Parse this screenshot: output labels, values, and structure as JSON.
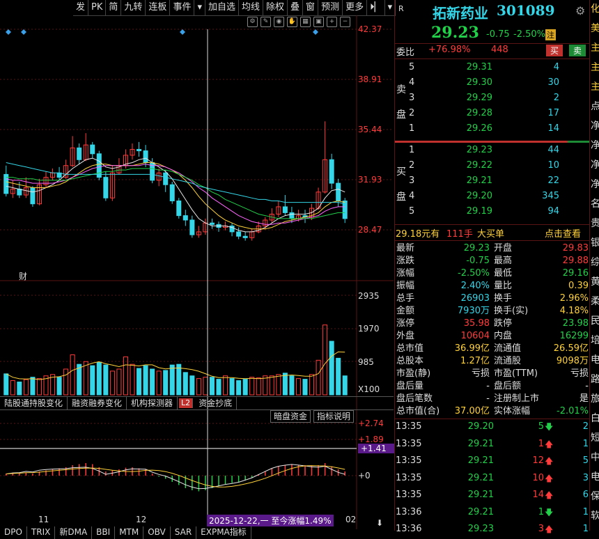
{
  "toolbar": {
    "items": [
      "发",
      "PK",
      "简",
      "九转",
      "连板",
      "事件",
      "加自选",
      "均线",
      "除权",
      "叠",
      "窗",
      "预测",
      "更多"
    ]
  },
  "stock": {
    "name": "拓新药业",
    "code": "301089",
    "price": "29.23",
    "change": "-0.75",
    "change_pct": "-2.50%",
    "badge": "注",
    "r_label": "R"
  },
  "weibi": {
    "label": "委比",
    "pct": "+76.98%",
    "vol": "448",
    "buy": "买",
    "sell": "卖"
  },
  "sell_label": [
    "卖",
    "盘"
  ],
  "buy_label": [
    "买",
    "盘"
  ],
  "asks": [
    {
      "n": "5",
      "p": "29.31",
      "v": "4"
    },
    {
      "n": "4",
      "p": "29.30",
      "v": "30"
    },
    {
      "n": "3",
      "p": "29.29",
      "v": "2"
    },
    {
      "n": "2",
      "p": "29.28",
      "v": "17"
    },
    {
      "n": "1",
      "p": "29.26",
      "v": "14"
    }
  ],
  "bids": [
    {
      "n": "1",
      "p": "29.23",
      "v": "44"
    },
    {
      "n": "2",
      "p": "29.22",
      "v": "10"
    },
    {
      "n": "3",
      "p": "29.21",
      "v": "22"
    },
    {
      "n": "4",
      "p": "29.20",
      "v": "345"
    },
    {
      "n": "5",
      "p": "29.19",
      "v": "94"
    }
  ],
  "big_order": {
    "price": "29.18元有",
    "hands": "111手",
    "label": "大买单",
    "link": "点击查看"
  },
  "stats": [
    [
      "最新",
      "29.23",
      "开盘",
      "29.83"
    ],
    [
      "涨跌",
      "-0.75",
      "最高",
      "29.88"
    ],
    [
      "涨幅",
      "-2.50%",
      "最低",
      "29.16"
    ],
    [
      "振幅",
      "2.40%",
      "量比",
      "0.39"
    ],
    [
      "总手",
      "26903",
      "换手",
      "2.96%"
    ],
    [
      "金额",
      "7930万",
      "换手(实)",
      "4.18%"
    ],
    [
      "涨停",
      "35.98",
      "跌停",
      "23.98"
    ],
    [
      "外盘",
      "10604",
      "内盘",
      "16299"
    ],
    [
      "总市值",
      "36.99亿",
      "流通值",
      "26.59亿"
    ],
    [
      "总股本",
      "1.27亿",
      "流通股",
      "9098万"
    ],
    [
      "市盈(静)",
      "亏损",
      "市盈(TTM)",
      "亏损"
    ],
    [
      "盘后量",
      "-",
      "盘后额",
      "-"
    ],
    [
      "盘后笔数",
      "-",
      "注册制上市",
      "是"
    ],
    [
      "总市值(合)",
      "37.00亿",
      "实体涨幅",
      "-2.01%"
    ]
  ],
  "ticks": [
    {
      "t": "13:35",
      "p": "29.20",
      "v": "5",
      "d": "down",
      "n": "2"
    },
    {
      "t": "13:35",
      "p": "29.21",
      "v": "1",
      "d": "up",
      "n": "1"
    },
    {
      "t": "13:35",
      "p": "29.21",
      "v": "12",
      "d": "up",
      "n": "5"
    },
    {
      "t": "13:35",
      "p": "29.21",
      "v": "10",
      "d": "up",
      "n": "3"
    },
    {
      "t": "13:35",
      "p": "29.21",
      "v": "14",
      "d": "up",
      "n": "6"
    },
    {
      "t": "13:36",
      "p": "29.21",
      "v": "1",
      "d": "down",
      "n": "1"
    },
    {
      "t": "13:36",
      "p": "29.23",
      "v": "3",
      "d": "up",
      "n": "1"
    }
  ],
  "price_axis": [
    "42.37",
    "38.91",
    "35.44",
    "31.93",
    "28.47"
  ],
  "vol_axis": [
    "2935",
    "1970",
    "985",
    "X100"
  ],
  "macd_axis": [
    {
      "v": "+2.74",
      "c": "#ff3b3b"
    },
    {
      "v": "+1.89",
      "c": "#ff3b3b"
    },
    {
      "v": "+1.41",
      "c": "#ffffff"
    },
    {
      "v": "+0",
      "c": "#dddddd"
    }
  ],
  "cai_label": "财",
  "tabs": [
    "陆股通持股变化",
    "融资融券变化",
    "机构探测器",
    "L2",
    "资金抄底"
  ],
  "sub_buttons": [
    "暗盘资金",
    "指标说明"
  ],
  "date_labels": [
    "11",
    "12",
    "02"
  ],
  "crosshair_note": "2025-12-22,一 至今涨幅1.49%",
  "bottom_tabs": [
    "DPO",
    "TRIX",
    "新DMA",
    "BBI",
    "MTM",
    "OBV",
    "SAR",
    "EXPMA指标"
  ],
  "far_right": [
    "化",
    "美",
    "主",
    "主",
    "主",
    "点",
    "净",
    "净",
    "净",
    "净",
    "名",
    "贵",
    "银",
    "综",
    "黄",
    "柔",
    "民",
    "培",
    "电",
    "路",
    "旅",
    "白",
    "短",
    "中",
    "电",
    "保",
    "软"
  ],
  "chart_data": {
    "type": "candlestick",
    "ylim": [
      27.5,
      43.0
    ],
    "candles": [
      [
        32.8,
        31.5,
        33.4,
        31.3
      ],
      [
        31.5,
        31.8,
        32.4,
        31.2
      ],
      [
        31.8,
        31.4,
        32.3,
        31.2
      ],
      [
        31.4,
        31.9,
        32.6,
        31.2
      ],
      [
        31.9,
        30.8,
        32.0,
        30.6
      ],
      [
        30.8,
        32.1,
        32.5,
        30.7
      ],
      [
        32.1,
        32.6,
        33.0,
        31.9
      ],
      [
        32.6,
        32.9,
        33.2,
        32.4
      ],
      [
        32.9,
        32.6,
        33.3,
        32.4
      ],
      [
        32.6,
        33.4,
        33.8,
        32.5
      ],
      [
        33.4,
        34.6,
        35.4,
        33.3
      ],
      [
        34.6,
        33.8,
        34.9,
        33.5
      ],
      [
        33.8,
        34.8,
        35.6,
        33.7
      ],
      [
        34.8,
        34.2,
        35.0,
        33.9
      ],
      [
        34.2,
        32.6,
        34.4,
        32.4
      ],
      [
        32.6,
        31.2,
        33.0,
        31.0
      ],
      [
        31.2,
        32.9,
        33.4,
        31.0
      ],
      [
        32.9,
        33.4,
        33.9,
        32.8
      ],
      [
        33.4,
        34.1,
        34.5,
        33.2
      ],
      [
        34.1,
        34.5,
        34.9,
        33.8
      ],
      [
        34.5,
        34.4,
        35.0,
        34.0
      ],
      [
        34.4,
        33.6,
        34.8,
        33.3
      ],
      [
        33.6,
        32.4,
        33.9,
        32.2
      ],
      [
        32.4,
        32.9,
        33.2,
        32.0
      ],
      [
        32.9,
        32.1,
        33.1,
        31.6
      ],
      [
        32.1,
        31.0,
        32.3,
        30.8
      ],
      [
        31.0,
        30.0,
        31.2,
        29.8
      ],
      [
        30.0,
        29.7,
        30.4,
        29.3
      ],
      [
        29.7,
        28.7,
        30.0,
        28.5
      ],
      [
        28.7,
        28.9,
        29.3,
        28.5
      ],
      [
        28.9,
        29.5,
        29.8,
        28.7
      ],
      [
        29.5,
        29.4,
        29.8,
        29.1
      ],
      [
        29.4,
        29.2,
        29.6,
        28.9
      ],
      [
        29.2,
        29.3,
        29.6,
        29.0
      ],
      [
        29.3,
        28.9,
        29.5,
        28.6
      ],
      [
        28.9,
        28.6,
        29.2,
        28.4
      ],
      [
        28.6,
        28.5,
        28.9,
        28.3
      ],
      [
        28.5,
        28.9,
        29.1,
        28.3
      ],
      [
        28.9,
        29.3,
        29.6,
        28.8
      ],
      [
        29.3,
        29.7,
        29.9,
        29.1
      ],
      [
        29.7,
        30.1,
        30.5,
        29.5
      ],
      [
        30.1,
        30.6,
        31.0,
        29.9
      ],
      [
        30.6,
        30.2,
        31.4,
        30.0
      ],
      [
        30.2,
        29.8,
        30.6,
        29.5
      ],
      [
        29.8,
        30.0,
        30.4,
        29.6
      ],
      [
        30.0,
        29.9,
        30.4,
        29.5
      ],
      [
        29.9,
        30.5,
        30.8,
        29.7
      ],
      [
        30.5,
        31.6,
        31.9,
        30.4
      ],
      [
        31.6,
        33.8,
        36.4,
        31.5
      ],
      [
        33.8,
        32.2,
        34.2,
        31.8
      ],
      [
        32.2,
        31.0,
        32.5,
        30.6
      ],
      [
        31.0,
        29.8,
        31.2,
        29.5
      ]
    ],
    "ma_lines": [
      {
        "color": "#e8e8e8",
        "values": [
          32.0,
          31.9,
          31.8,
          31.7,
          31.6,
          31.7,
          31.9,
          32.1,
          32.4,
          32.8,
          33.2,
          33.5,
          33.8,
          33.9,
          33.7,
          33.3,
          33.2,
          33.3,
          33.5,
          33.6,
          33.8,
          33.9,
          33.6,
          33.3,
          33.0,
          32.5,
          31.8,
          31.1,
          30.4,
          29.8,
          29.5,
          29.3,
          29.3,
          29.3,
          29.2,
          29.0,
          28.9,
          28.9,
          29.0,
          29.2,
          29.5,
          29.8,
          30.0,
          30.1,
          30.1,
          30.1,
          30.2,
          30.5,
          31.2,
          31.7,
          31.8,
          31.6
        ]
      },
      {
        "color": "#ffd23a",
        "values": [
          32.3,
          32.2,
          32.1,
          32.0,
          31.9,
          31.9,
          31.9,
          32.0,
          32.1,
          32.3,
          32.6,
          32.9,
          33.2,
          33.4,
          33.5,
          33.5,
          33.4,
          33.4,
          33.4,
          33.4,
          33.5,
          33.6,
          33.6,
          33.5,
          33.3,
          33.1,
          32.8,
          32.4,
          31.9,
          31.3,
          30.8,
          30.4,
          30.0,
          29.7,
          29.5,
          29.3,
          29.2,
          29.1,
          29.1,
          29.1,
          29.2,
          29.4,
          29.6,
          29.7,
          29.8,
          29.9,
          30.0,
          30.2,
          30.6,
          30.9,
          31.0,
          30.9
        ]
      },
      {
        "color": "#ff66ff",
        "values": [
          32.5,
          32.4,
          32.4,
          32.3,
          32.2,
          32.2,
          32.2,
          32.2,
          32.3,
          32.4,
          32.6,
          32.8,
          33.0,
          33.2,
          33.3,
          33.4,
          33.4,
          33.4,
          33.4,
          33.4,
          33.4,
          33.5,
          33.4,
          33.4,
          33.3,
          33.1,
          32.9,
          32.6,
          32.3,
          31.9,
          31.6,
          31.2,
          30.9,
          30.6,
          30.3,
          30.0,
          29.8,
          29.6,
          29.5,
          29.4,
          29.4,
          29.5,
          29.5,
          29.6,
          29.7,
          29.8,
          29.9,
          30.0,
          30.3,
          30.5,
          30.6,
          30.6
        ]
      },
      {
        "color": "#22d04a",
        "values": [
          32.6,
          32.6,
          32.5,
          32.5,
          32.5,
          32.4,
          32.4,
          32.4,
          32.4,
          32.4,
          32.5,
          32.6,
          32.7,
          32.8,
          32.9,
          33.0,
          33.0,
          33.1,
          33.1,
          33.2,
          33.2,
          33.2,
          33.2,
          33.1,
          33.1,
          33.0,
          32.8,
          32.6,
          32.4,
          32.1,
          31.9,
          31.6,
          31.4,
          31.1,
          30.9,
          30.7,
          30.5,
          30.3,
          30.1,
          30.0,
          29.9,
          29.8,
          29.8,
          29.8,
          29.8,
          29.8,
          29.8,
          29.9,
          30.0,
          30.1,
          30.2,
          30.2
        ]
      },
      {
        "color": "#34d6e8",
        "values": [
          33.6,
          33.5,
          33.4,
          33.3,
          33.2,
          33.1,
          33.0,
          32.9,
          32.9,
          32.8,
          32.8,
          32.8,
          32.8,
          32.8,
          32.8,
          32.8,
          32.8,
          32.8,
          32.8,
          32.8,
          32.8,
          32.8,
          32.8,
          32.7,
          32.6,
          32.5,
          32.4,
          32.3,
          32.2,
          32.0,
          31.9,
          31.8,
          31.7,
          31.6,
          31.5,
          31.4,
          31.3,
          31.2,
          31.1,
          31.1,
          31.0,
          31.0,
          30.9,
          30.9,
          30.9,
          30.9,
          30.9,
          30.9,
          30.9,
          30.9,
          30.9,
          30.8
        ]
      }
    ],
    "volume": [
      620,
      420,
      380,
      450,
      520,
      480,
      560,
      600,
      520,
      760,
      1180,
      900,
      980,
      860,
      960,
      880,
      700,
      760,
      1120,
      900,
      780,
      860,
      760,
      700,
      720,
      880,
      900,
      660,
      560,
      480,
      520,
      520,
      460,
      560,
      480,
      420,
      460,
      520,
      500,
      560,
      560,
      600,
      640,
      560,
      480,
      460,
      600,
      1020,
      2060,
      1580,
      1080,
      560
    ],
    "vol_ylim": [
      0,
      3000
    ],
    "macd_hist": [
      0.1,
      0.12,
      0.1,
      0.15,
      0.1,
      0.2,
      0.25,
      0.3,
      0.35,
      0.4,
      0.5,
      0.55,
      0.6,
      0.55,
      0.4,
      0.2,
      0.25,
      0.3,
      0.38,
      0.4,
      0.35,
      0.3,
      0.1,
      -0.05,
      -0.15,
      -0.3,
      -0.45,
      -0.6,
      -0.7,
      -0.75,
      -0.7,
      -0.6,
      -0.5,
      -0.4,
      -0.35,
      -0.3,
      -0.2,
      -0.1,
      0.05,
      0.2,
      0.35,
      0.45,
      0.5,
      0.55,
      0.52,
      0.5,
      0.48,
      0.5,
      0.6,
      0.45,
      0.3,
      0.2
    ],
    "macd_ylim": [
      -1.2,
      2.9
    ]
  }
}
